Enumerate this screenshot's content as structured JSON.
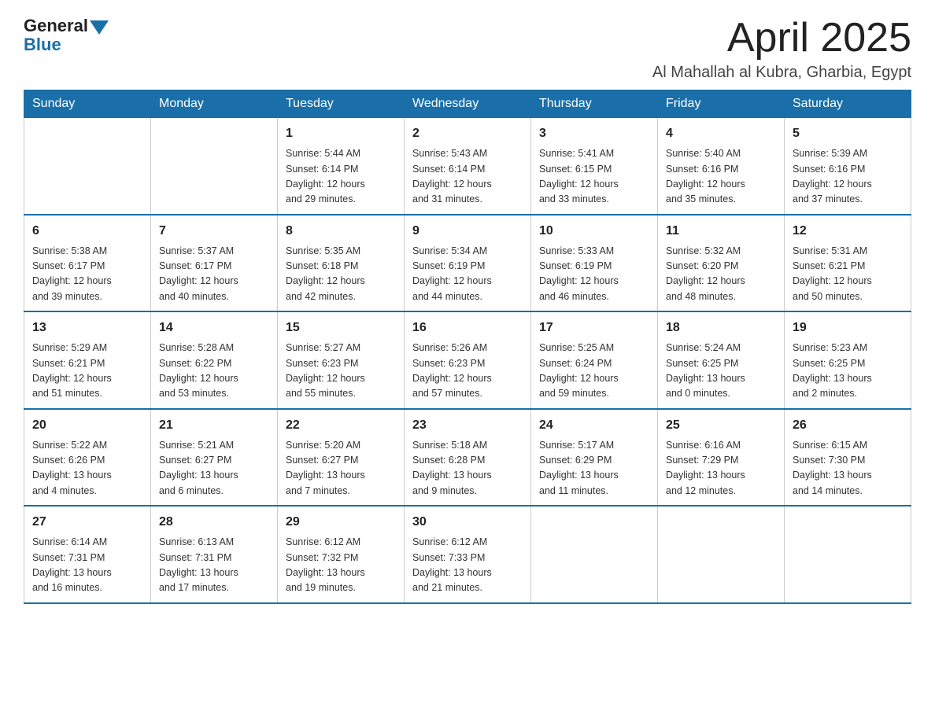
{
  "header": {
    "logo": {
      "text_general": "General",
      "text_blue": "Blue"
    },
    "title": "April 2025",
    "subtitle": "Al Mahallah al Kubra, Gharbia, Egypt"
  },
  "calendar": {
    "weekdays": [
      "Sunday",
      "Monday",
      "Tuesday",
      "Wednesday",
      "Thursday",
      "Friday",
      "Saturday"
    ],
    "weeks": [
      [
        {
          "day": "",
          "info": ""
        },
        {
          "day": "",
          "info": ""
        },
        {
          "day": "1",
          "info": "Sunrise: 5:44 AM\nSunset: 6:14 PM\nDaylight: 12 hours\nand 29 minutes."
        },
        {
          "day": "2",
          "info": "Sunrise: 5:43 AM\nSunset: 6:14 PM\nDaylight: 12 hours\nand 31 minutes."
        },
        {
          "day": "3",
          "info": "Sunrise: 5:41 AM\nSunset: 6:15 PM\nDaylight: 12 hours\nand 33 minutes."
        },
        {
          "day": "4",
          "info": "Sunrise: 5:40 AM\nSunset: 6:16 PM\nDaylight: 12 hours\nand 35 minutes."
        },
        {
          "day": "5",
          "info": "Sunrise: 5:39 AM\nSunset: 6:16 PM\nDaylight: 12 hours\nand 37 minutes."
        }
      ],
      [
        {
          "day": "6",
          "info": "Sunrise: 5:38 AM\nSunset: 6:17 PM\nDaylight: 12 hours\nand 39 minutes."
        },
        {
          "day": "7",
          "info": "Sunrise: 5:37 AM\nSunset: 6:17 PM\nDaylight: 12 hours\nand 40 minutes."
        },
        {
          "day": "8",
          "info": "Sunrise: 5:35 AM\nSunset: 6:18 PM\nDaylight: 12 hours\nand 42 minutes."
        },
        {
          "day": "9",
          "info": "Sunrise: 5:34 AM\nSunset: 6:19 PM\nDaylight: 12 hours\nand 44 minutes."
        },
        {
          "day": "10",
          "info": "Sunrise: 5:33 AM\nSunset: 6:19 PM\nDaylight: 12 hours\nand 46 minutes."
        },
        {
          "day": "11",
          "info": "Sunrise: 5:32 AM\nSunset: 6:20 PM\nDaylight: 12 hours\nand 48 minutes."
        },
        {
          "day": "12",
          "info": "Sunrise: 5:31 AM\nSunset: 6:21 PM\nDaylight: 12 hours\nand 50 minutes."
        }
      ],
      [
        {
          "day": "13",
          "info": "Sunrise: 5:29 AM\nSunset: 6:21 PM\nDaylight: 12 hours\nand 51 minutes."
        },
        {
          "day": "14",
          "info": "Sunrise: 5:28 AM\nSunset: 6:22 PM\nDaylight: 12 hours\nand 53 minutes."
        },
        {
          "day": "15",
          "info": "Sunrise: 5:27 AM\nSunset: 6:23 PM\nDaylight: 12 hours\nand 55 minutes."
        },
        {
          "day": "16",
          "info": "Sunrise: 5:26 AM\nSunset: 6:23 PM\nDaylight: 12 hours\nand 57 minutes."
        },
        {
          "day": "17",
          "info": "Sunrise: 5:25 AM\nSunset: 6:24 PM\nDaylight: 12 hours\nand 59 minutes."
        },
        {
          "day": "18",
          "info": "Sunrise: 5:24 AM\nSunset: 6:25 PM\nDaylight: 13 hours\nand 0 minutes."
        },
        {
          "day": "19",
          "info": "Sunrise: 5:23 AM\nSunset: 6:25 PM\nDaylight: 13 hours\nand 2 minutes."
        }
      ],
      [
        {
          "day": "20",
          "info": "Sunrise: 5:22 AM\nSunset: 6:26 PM\nDaylight: 13 hours\nand 4 minutes."
        },
        {
          "day": "21",
          "info": "Sunrise: 5:21 AM\nSunset: 6:27 PM\nDaylight: 13 hours\nand 6 minutes."
        },
        {
          "day": "22",
          "info": "Sunrise: 5:20 AM\nSunset: 6:27 PM\nDaylight: 13 hours\nand 7 minutes."
        },
        {
          "day": "23",
          "info": "Sunrise: 5:18 AM\nSunset: 6:28 PM\nDaylight: 13 hours\nand 9 minutes."
        },
        {
          "day": "24",
          "info": "Sunrise: 5:17 AM\nSunset: 6:29 PM\nDaylight: 13 hours\nand 11 minutes."
        },
        {
          "day": "25",
          "info": "Sunrise: 6:16 AM\nSunset: 7:29 PM\nDaylight: 13 hours\nand 12 minutes."
        },
        {
          "day": "26",
          "info": "Sunrise: 6:15 AM\nSunset: 7:30 PM\nDaylight: 13 hours\nand 14 minutes."
        }
      ],
      [
        {
          "day": "27",
          "info": "Sunrise: 6:14 AM\nSunset: 7:31 PM\nDaylight: 13 hours\nand 16 minutes."
        },
        {
          "day": "28",
          "info": "Sunrise: 6:13 AM\nSunset: 7:31 PM\nDaylight: 13 hours\nand 17 minutes."
        },
        {
          "day": "29",
          "info": "Sunrise: 6:12 AM\nSunset: 7:32 PM\nDaylight: 13 hours\nand 19 minutes."
        },
        {
          "day": "30",
          "info": "Sunrise: 6:12 AM\nSunset: 7:33 PM\nDaylight: 13 hours\nand 21 minutes."
        },
        {
          "day": "",
          "info": ""
        },
        {
          "day": "",
          "info": ""
        },
        {
          "day": "",
          "info": ""
        }
      ]
    ]
  }
}
